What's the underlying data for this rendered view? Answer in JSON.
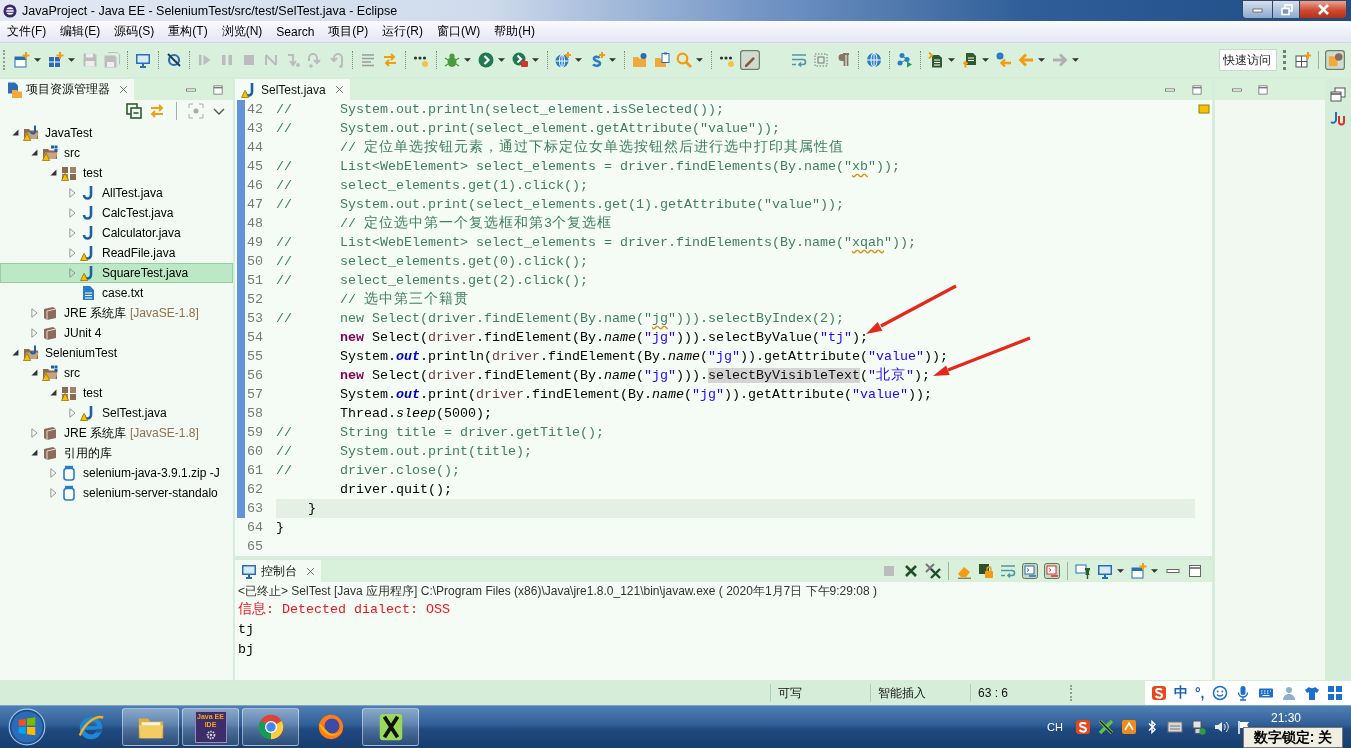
{
  "window": {
    "title": "JavaProject - Java EE - SeleniumTest/src/test/SelTest.java - Eclipse"
  },
  "menu": [
    "文件(F)",
    "编辑(E)",
    "源码(S)",
    "重构(T)",
    "浏览(N)",
    "Search",
    "项目(P)",
    "运行(R)",
    "窗口(W)",
    "帮助(H)"
  ],
  "toolbar": {
    "quick_access": {
      "placeholder": "快速访问"
    }
  },
  "explorer": {
    "tabs": [
      {
        "label": "项目资源管理器",
        "selected": true
      }
    ],
    "tree": [
      {
        "label": "JavaTest",
        "kind": "project",
        "warning": true,
        "selected": false,
        "expanded": true,
        "children": [
          {
            "label": "src",
            "kind": "source-folder",
            "warning": true,
            "selected": false,
            "expanded": true,
            "children": [
              {
                "label": "test",
                "kind": "package",
                "warning": true,
                "selected": false,
                "expanded": true,
                "children": [
                  {
                    "label": "AllTest.java",
                    "kind": "java",
                    "warning": false,
                    "selected": false,
                    "expanded": false
                  },
                  {
                    "label": "CalcTest.java",
                    "kind": "java",
                    "warning": false,
                    "selected": false,
                    "expanded": false
                  },
                  {
                    "label": "Calculator.java",
                    "kind": "java",
                    "warning": false,
                    "selected": false,
                    "expanded": false
                  },
                  {
                    "label": "ReadFile.java",
                    "kind": "java",
                    "warning": true,
                    "selected": false,
                    "expanded": false
                  },
                  {
                    "label": "SquareTest.java",
                    "kind": "java",
                    "warning": true,
                    "selected": true,
                    "expanded": false
                  },
                  {
                    "label": "case.txt",
                    "kind": "text",
                    "warning": false,
                    "selected": false
                  }
                ]
              }
            ]
          },
          {
            "label": "JRE 系统库",
            "decoration": "[JavaSE-1.8]",
            "kind": "library",
            "warning": false,
            "selected": false,
            "expanded": false
          },
          {
            "label": "JUnit 4",
            "kind": "library",
            "warning": false,
            "selected": false,
            "expanded": false
          }
        ]
      },
      {
        "label": "SeleniumTest",
        "kind": "project",
        "warning": true,
        "selected": false,
        "expanded": true,
        "children": [
          {
            "label": "src",
            "kind": "source-folder",
            "warning": true,
            "selected": false,
            "expanded": true,
            "children": [
              {
                "label": "test",
                "kind": "package",
                "warning": true,
                "selected": false,
                "expanded": true,
                "children": [
                  {
                    "label": "SelTest.java",
                    "kind": "java",
                    "warning": true,
                    "selected": false,
                    "expanded": false
                  }
                ]
              }
            ]
          },
          {
            "label": "JRE 系统库",
            "decoration": "[JavaSE-1.8]",
            "kind": "library",
            "warning": false,
            "selected": false,
            "expanded": false
          },
          {
            "label": "引用的库",
            "kind": "library",
            "warning": false,
            "selected": false,
            "expanded": true,
            "children": [
              {
                "label": "selenium-java-3.9.1.zip -J",
                "kind": "jar",
                "warning": false,
                "selected": false,
                "expanded": false
              },
              {
                "label": "selenium-server-standalo",
                "kind": "jar",
                "warning": false,
                "selected": false,
                "expanded": false
              }
            ]
          }
        ]
      }
    ]
  },
  "editor": {
    "tabs": [
      {
        "label": "SelTest.java",
        "selected": true,
        "warning": true
      }
    ],
    "lines": [
      {
        "number": "42",
        "current": false,
        "segments": [
          {
            "text": "//\t\tSystem.out.println(select_element.isSelected());",
            "kind": "comment"
          }
        ]
      },
      {
        "number": "43",
        "current": false,
        "segments": [
          {
            "text": "//\t\tSystem.out.print(select_element.getAttribute(\"value\"));",
            "kind": "comment"
          }
        ]
      },
      {
        "number": "44",
        "current": false,
        "segments": [
          {
            "text": "\t\t// 定位单选按钮元素，通过下标定位女单选按钮然后进行选中打印其属性值",
            "kind": "comment"
          }
        ]
      },
      {
        "number": "45",
        "current": false,
        "segments": [
          {
            "text": "//\t\tList<WebElement> select_elements = driver.findElements(By.name(\"",
            "kind": "comment"
          },
          {
            "text": "xb",
            "kind": "typo"
          },
          {
            "text": "\"));",
            "kind": "comment"
          }
        ]
      },
      {
        "number": "46",
        "current": false,
        "segments": [
          {
            "text": "//\t\tselect_elements.get(1).click();",
            "kind": "comment"
          }
        ]
      },
      {
        "number": "47",
        "current": false,
        "segments": [
          {
            "text": "//\t\tSystem.out.print(select_elements.get(1).getAttribute(\"value\"));",
            "kind": "comment"
          }
        ]
      },
      {
        "number": "48",
        "current": false,
        "segments": [
          {
            "text": "\t\t// 定位选中第一个复选框和第3个复选框",
            "kind": "comment"
          }
        ]
      },
      {
        "number": "49",
        "current": false,
        "segments": [
          {
            "text": "//\t\tList<WebElement> select_elements = driver.findElements(By.name(\"",
            "kind": "comment"
          },
          {
            "text": "xqah",
            "kind": "typo"
          },
          {
            "text": "\"));",
            "kind": "comment"
          }
        ]
      },
      {
        "number": "50",
        "current": false,
        "segments": [
          {
            "text": "//\t\tselect_elements.get(0).click();",
            "kind": "comment"
          }
        ]
      },
      {
        "number": "51",
        "current": false,
        "segments": [
          {
            "text": "//\t\tselect_elements.get(2).click();",
            "kind": "comment"
          }
        ]
      },
      {
        "number": "52",
        "current": false,
        "segments": [
          {
            "text": "\t\t// 选中第三个籍贯",
            "kind": "comment"
          }
        ]
      },
      {
        "number": "53",
        "current": false,
        "segments": [
          {
            "text": "//\t\tnew Select(driver.findElement(By.name(\"",
            "kind": "comment"
          },
          {
            "text": "jg",
            "kind": "typo"
          },
          {
            "text": "\"))).selectByIndex(2);",
            "kind": "comment"
          }
        ]
      },
      {
        "number": "54",
        "current": false,
        "segments": [
          {
            "text": "\t\tnew",
            "kind": "keyword"
          },
          {
            "text": " Select(",
            "kind": "plain"
          },
          {
            "text": "driver",
            "kind": "variable"
          },
          {
            "text": ".findElement(By.",
            "kind": "plain"
          },
          {
            "text": "name",
            "kind": "static"
          },
          {
            "text": "(",
            "kind": "plain"
          },
          {
            "text": "\"jg\"",
            "kind": "string"
          },
          {
            "text": "))).selectByValue(",
            "kind": "plain"
          },
          {
            "text": "\"tj\"",
            "kind": "string"
          },
          {
            "text": ");",
            "kind": "plain"
          }
        ]
      },
      {
        "number": "55",
        "current": false,
        "segments": [
          {
            "text": "\t\tSystem.",
            "kind": "plain"
          },
          {
            "text": "out",
            "kind": "field"
          },
          {
            "text": ".println(",
            "kind": "plain"
          },
          {
            "text": "driver",
            "kind": "variable"
          },
          {
            "text": ".findElement(By.",
            "kind": "plain"
          },
          {
            "text": "name",
            "kind": "static"
          },
          {
            "text": "(",
            "kind": "plain"
          },
          {
            "text": "\"jg\"",
            "kind": "string"
          },
          {
            "text": ")).getAttribute(",
            "kind": "plain"
          },
          {
            "text": "\"value\"",
            "kind": "string"
          },
          {
            "text": "));",
            "kind": "plain"
          }
        ]
      },
      {
        "number": "56",
        "current": false,
        "segments": [
          {
            "text": "\t\tnew",
            "kind": "keyword"
          },
          {
            "text": " Select(",
            "kind": "plain"
          },
          {
            "text": "driver",
            "kind": "variable"
          },
          {
            "text": ".findElement(By.",
            "kind": "plain"
          },
          {
            "text": "name",
            "kind": "static"
          },
          {
            "text": "(",
            "kind": "plain"
          },
          {
            "text": "\"jg\"",
            "kind": "string"
          },
          {
            "text": "))).",
            "kind": "plain"
          },
          {
            "text": "selectByVisibleText",
            "kind": "occurrence"
          },
          {
            "text": "(",
            "kind": "plain"
          },
          {
            "text": "\"北京\"",
            "kind": "string"
          },
          {
            "text": ");",
            "kind": "plain"
          }
        ]
      },
      {
        "number": "57",
        "current": false,
        "segments": [
          {
            "text": "\t\tSystem.",
            "kind": "plain"
          },
          {
            "text": "out",
            "kind": "field"
          },
          {
            "text": ".print(",
            "kind": "plain"
          },
          {
            "text": "driver",
            "kind": "variable"
          },
          {
            "text": ".findElement(By.",
            "kind": "plain"
          },
          {
            "text": "name",
            "kind": "static"
          },
          {
            "text": "(",
            "kind": "plain"
          },
          {
            "text": "\"jg\"",
            "kind": "string"
          },
          {
            "text": ")).getAttribute(",
            "kind": "plain"
          },
          {
            "text": "\"value\"",
            "kind": "string"
          },
          {
            "text": "));",
            "kind": "plain"
          }
        ]
      },
      {
        "number": "58",
        "current": false,
        "segments": [
          {
            "text": "\t\tThread.",
            "kind": "plain"
          },
          {
            "text": "sleep",
            "kind": "static"
          },
          {
            "text": "(5000);",
            "kind": "plain"
          }
        ]
      },
      {
        "number": "59",
        "current": false,
        "segments": [
          {
            "text": "//\t\tString title = driver.getTitle();",
            "kind": "comment"
          }
        ]
      },
      {
        "number": "60",
        "current": false,
        "segments": [
          {
            "text": "//\t\tSystem.out.print(title);",
            "kind": "comment"
          }
        ]
      },
      {
        "number": "61",
        "current": false,
        "segments": [
          {
            "text": "//\t\tdriver.close();",
            "kind": "comment"
          }
        ]
      },
      {
        "number": "62",
        "current": false,
        "segments": [
          {
            "text": "\t\tdriver.quit();",
            "kind": "plain"
          }
        ]
      },
      {
        "number": "63",
        "current": true,
        "segments": [
          {
            "text": "\t}",
            "kind": "plain"
          }
        ]
      },
      {
        "number": "64",
        "current": false,
        "segments": [
          {
            "text": "}",
            "kind": "plain"
          }
        ]
      },
      {
        "number": "65",
        "current": false
      }
    ]
  },
  "console": {
    "tabs": [
      {
        "label": "控制台",
        "selected": true
      }
    ],
    "info": "<已终止> SelTest [Java 应用程序] C:\\Program Files (x86)\\Java\\jre1.8.0_121\\bin\\javaw.exe ( 2020年1月7日 下午9:29:08 )",
    "output": [
      {
        "text": "信息: Detected dialect: OSS",
        "kind": "error"
      },
      {
        "text": "tj",
        "kind": "output"
      },
      {
        "text": "bj",
        "kind": "output"
      }
    ]
  },
  "status_bar": [
    "可写",
    "智能插入",
    "63 : 6"
  ],
  "ime": {
    "items": [
      "中",
      "°,"
    ]
  },
  "taskbar": {
    "apps": [
      {
        "kind": "ie",
        "running": false
      },
      {
        "kind": "explorer",
        "running": true
      },
      {
        "kind": "ide",
        "label": "Java EE IDE",
        "running": true
      },
      {
        "kind": "chrome",
        "running": true
      },
      {
        "kind": "firefox",
        "running": false
      },
      {
        "kind": "x-logo",
        "running": true
      }
    ],
    "tray": {
      "language": "CH",
      "clock": "21:30",
      "tooltip": "数字锁定: 关"
    }
  }
}
